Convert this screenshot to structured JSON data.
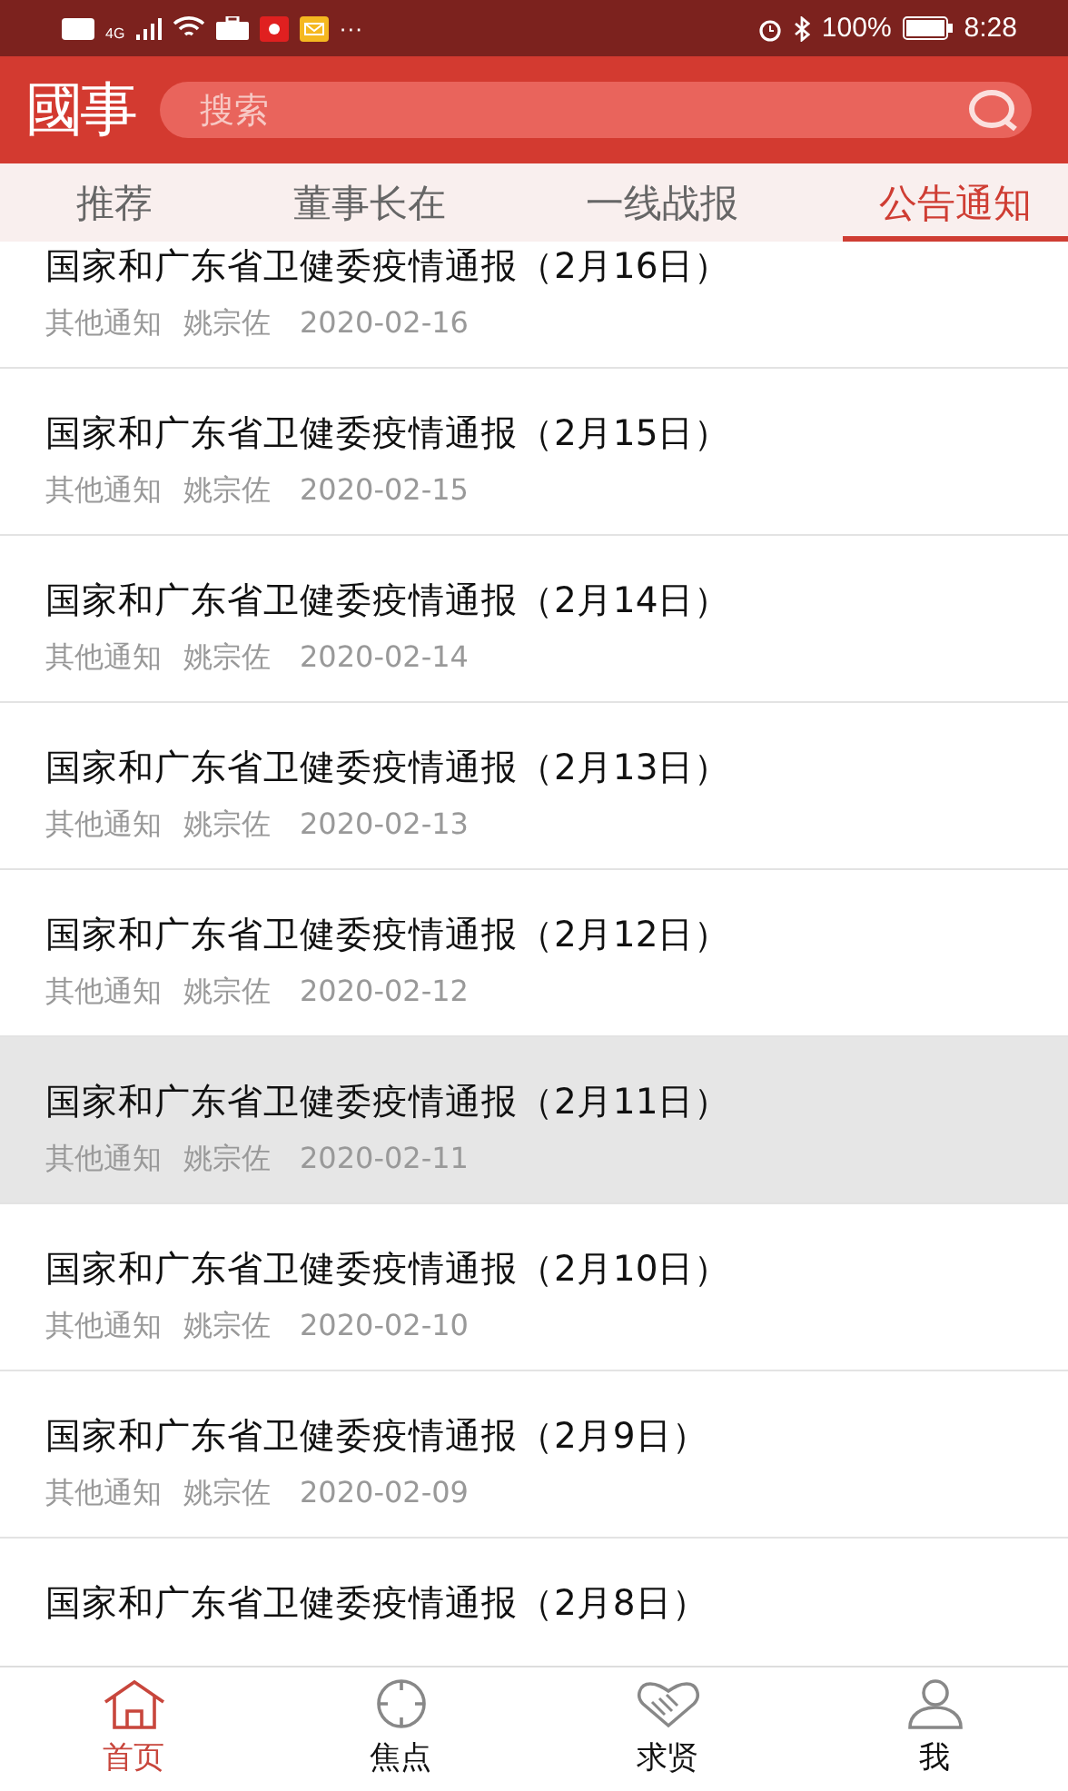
{
  "status_bar": {
    "network": "4G",
    "battery": "100%",
    "time": "8:28",
    "more": "···"
  },
  "header": {
    "logo": "國事",
    "search": {
      "placeholder": "搜索"
    }
  },
  "tabs": [
    {
      "label": "推荐",
      "selected": false
    },
    {
      "label": "董事长在",
      "selected": false
    },
    {
      "label": "一线战报",
      "selected": false
    },
    {
      "label": "公告通知",
      "selected": true
    }
  ],
  "articles": [
    {
      "title": "国家和广东省卫健委疫情通报（2月16日）",
      "category": "其他通知",
      "author": "姚宗佐",
      "date": "2020-02-16",
      "selected": false
    },
    {
      "title": "国家和广东省卫健委疫情通报（2月15日）",
      "category": "其他通知",
      "author": "姚宗佐",
      "date": "2020-02-15",
      "selected": false
    },
    {
      "title": "国家和广东省卫健委疫情通报（2月14日）",
      "category": "其他通知",
      "author": "姚宗佐",
      "date": "2020-02-14",
      "selected": false
    },
    {
      "title": "国家和广东省卫健委疫情通报（2月13日）",
      "category": "其他通知",
      "author": "姚宗佐",
      "date": "2020-02-13",
      "selected": false
    },
    {
      "title": "国家和广东省卫健委疫情通报（2月12日）",
      "category": "其他通知",
      "author": "姚宗佐",
      "date": "2020-02-12",
      "selected": false
    },
    {
      "title": "国家和广东省卫健委疫情通报（2月11日）",
      "category": "其他通知",
      "author": "姚宗佐",
      "date": "2020-02-11",
      "selected": true
    },
    {
      "title": "国家和广东省卫健委疫情通报（2月10日）",
      "category": "其他通知",
      "author": "姚宗佐",
      "date": "2020-02-10",
      "selected": false
    },
    {
      "title": "国家和广东省卫健委疫情通报（2月9日）",
      "category": "其他通知",
      "author": "姚宗佐",
      "date": "2020-02-09",
      "selected": false
    },
    {
      "title": "国家和广东省卫健委疫情通报（2月8日）",
      "selected": false
    }
  ],
  "bottom_nav": [
    {
      "label": "首页",
      "kind": "home",
      "selected": true
    },
    {
      "label": "焦点",
      "kind": "focus",
      "selected": false
    },
    {
      "label": "求贤",
      "kind": "handshake",
      "selected": false
    },
    {
      "label": "我",
      "kind": "profile",
      "selected": false
    }
  ]
}
